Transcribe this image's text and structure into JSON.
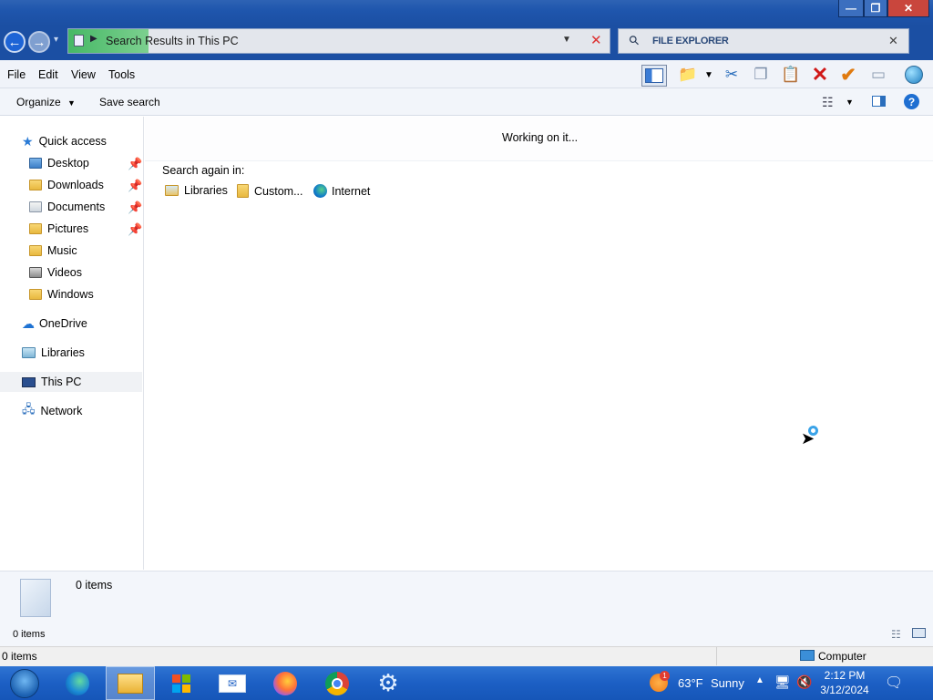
{
  "window": {
    "minimize_glyph": "—",
    "maximize_glyph": "❐",
    "close_glyph": "✕"
  },
  "address": {
    "path": "Search Results in This PC",
    "search_placeholder": "FILE EXPLORER"
  },
  "menu": [
    "File",
    "Edit",
    "View",
    "Tools"
  ],
  "commands": {
    "organize": "Organize",
    "save_search": "Save search"
  },
  "nav": {
    "quick_access": "Quick access",
    "quick_items": [
      {
        "label": "Desktop",
        "pinned": true
      },
      {
        "label": "Downloads",
        "pinned": true
      },
      {
        "label": "Documents",
        "pinned": true
      },
      {
        "label": "Pictures",
        "pinned": true
      },
      {
        "label": "Music",
        "pinned": false
      },
      {
        "label": "Videos",
        "pinned": false
      },
      {
        "label": "Windows",
        "pinned": false
      }
    ],
    "onedrive": "OneDrive",
    "libraries": "Libraries",
    "this_pc": "This PC",
    "network": "Network"
  },
  "content": {
    "status": "Working on it...",
    "search_again": "Search again in:",
    "locations": [
      "Libraries",
      "Custom...",
      "Internet"
    ]
  },
  "details": {
    "count": "0 items",
    "bottom_count": "0 items"
  },
  "statusbar": {
    "left": "0 items",
    "right": "Computer"
  },
  "taskbar": {
    "weather_temp": "63°F",
    "weather_desc": "Sunny",
    "weather_badge": "1",
    "time": "2:12 PM",
    "date": "3/12/2024"
  },
  "colors": {
    "accent": "#1c5fc4",
    "titlebar": "#1f56ad",
    "highlight": "#2ea043"
  }
}
